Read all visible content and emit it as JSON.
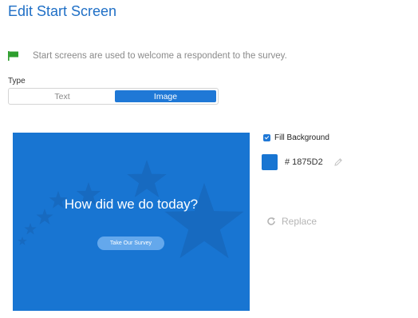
{
  "page": {
    "title": "Edit Start Screen",
    "info_text": "Start screens are used to welcome a respondent to the survey."
  },
  "type_selector": {
    "label": "Type",
    "options": [
      "Text",
      "Image"
    ],
    "selected": "Image"
  },
  "preview": {
    "question": "How did we do today?",
    "button_label": "Take Our Survey",
    "background_color": "#1875D2"
  },
  "background": {
    "fill_label": "Fill Background",
    "fill_checked": true,
    "hex_display": "# 1875D2",
    "color": "#1875D2"
  },
  "actions": {
    "replace_label": "Replace"
  },
  "icons": {
    "info": "flag-icon",
    "edit": "pencil-icon",
    "replace": "refresh-icon"
  }
}
